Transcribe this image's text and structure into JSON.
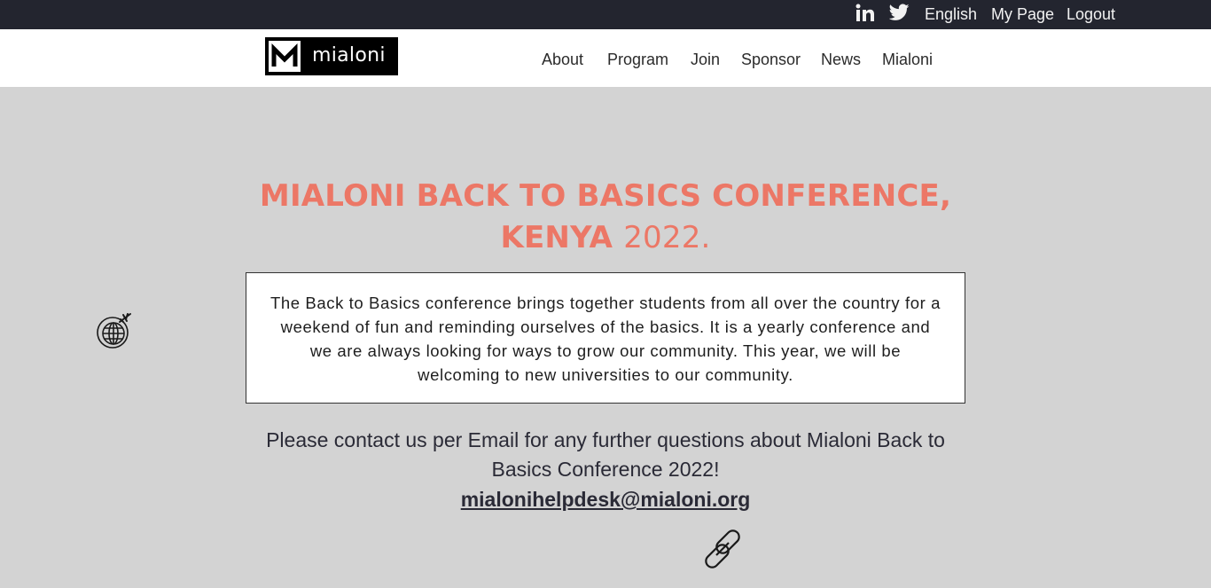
{
  "topbar": {
    "icons": [
      "linkedin-icon",
      "twitter-icon"
    ],
    "language": "English",
    "my_page": "My Page",
    "logout": "Logout"
  },
  "brand": {
    "logo_text": "mialoni"
  },
  "nav": {
    "items": [
      "About",
      "Program",
      "Join",
      "Sponsor",
      "News",
      "Mialoni"
    ]
  },
  "hero": {
    "title_line1": "MIALONI BACK TO BASICS CONFERENCE,",
    "title_line2_bold": "KENYA",
    "title_line2_year": "2022."
  },
  "description": "The Back to Basics conference brings together students from all over the country for a weekend of fun and reminding ourselves of the basics. It is a yearly conference and we are always looking for ways to grow our community. This year, we will be welcoming to new universities to our community.",
  "contact": {
    "text": "Please contact us per Email for any further questions about Mialoni Back to Basics Conference 2022!",
    "email": "mialonihelpdesk@mialoni.org"
  },
  "decor_icons": [
    "globe-plane-icon",
    "chain-link-icon"
  ],
  "colors": {
    "topbar_bg": "#23252f",
    "page_bg": "#d3d3d3",
    "title_accent": "#ec7766"
  }
}
